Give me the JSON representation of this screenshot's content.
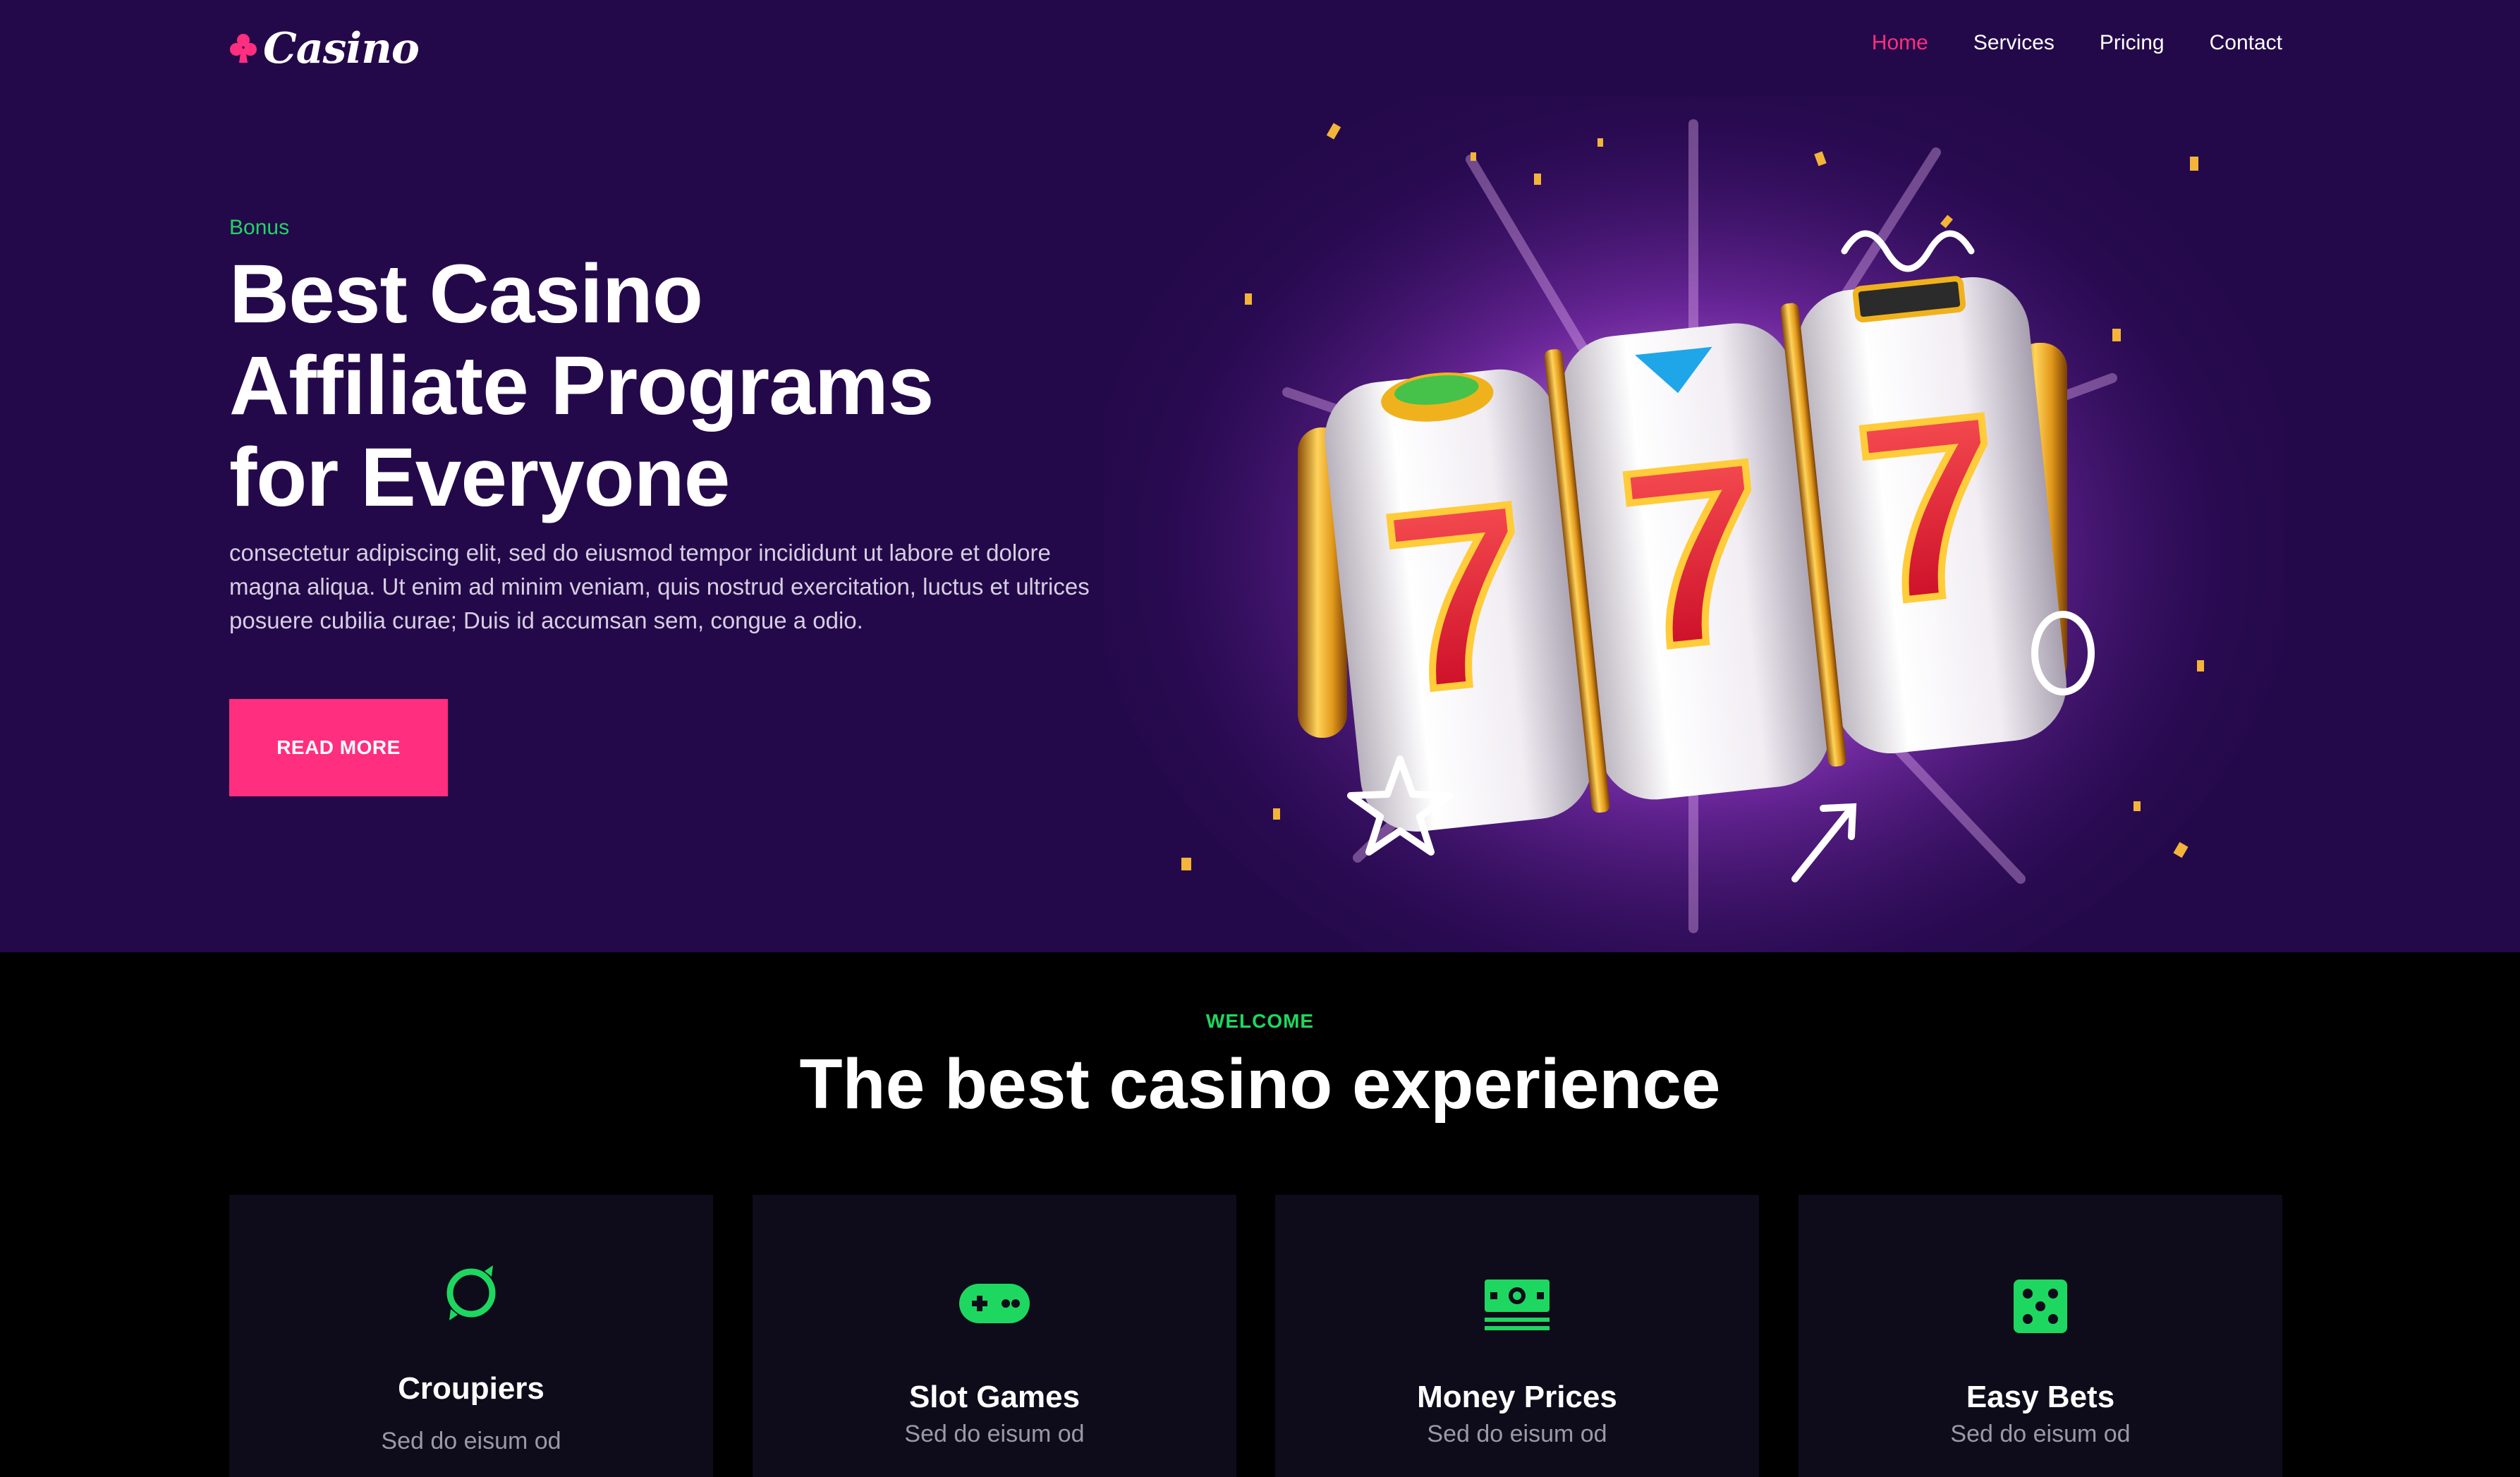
{
  "nav": {
    "logo_text": "Casino",
    "logo_icon": "club-icon",
    "items": [
      {
        "label": "Home",
        "active": true
      },
      {
        "label": "Services",
        "active": false
      },
      {
        "label": "Pricing",
        "active": false
      },
      {
        "label": "Contact",
        "active": false
      }
    ]
  },
  "hero": {
    "eyebrow": "Bonus",
    "title_lines": [
      "Best Casino",
      "Affiliate Programs",
      "for Everyone"
    ],
    "description": "consectetur adipiscing elit, sed do eiusmod tempor incididunt ut labore et dolore magna aliqua. Ut enim ad minim veniam, quis nostrud exercitation, luctus et ultrices posuere cubilia curae; Duis id accumsan sem, congue a odio.",
    "button_label": "READ MORE",
    "image_icon": "slot-machine-777-icon"
  },
  "welcome": {
    "eyebrow": "WELCOME",
    "title": "The best casino experience"
  },
  "cards": [
    {
      "title": "Croupiers",
      "subtitle": "Sed do eisum od",
      "icon": "croupier-icon"
    },
    {
      "title": "Slot Games",
      "subtitle": "Sed do eisum od",
      "icon": "gamepad-icon"
    },
    {
      "title": "Money Prices",
      "subtitle": "Sed do eisum od",
      "icon": "money-icon"
    },
    {
      "title": "Easy Bets",
      "subtitle": "Sed do eisum od",
      "icon": "dice-icon"
    }
  ],
  "colors": {
    "hero_bg": "#24094a",
    "accent_pink": "#ff2e7f",
    "accent_green": "#1ed760",
    "card_bg": "#0e0c1a",
    "section_bg": "#000000"
  }
}
